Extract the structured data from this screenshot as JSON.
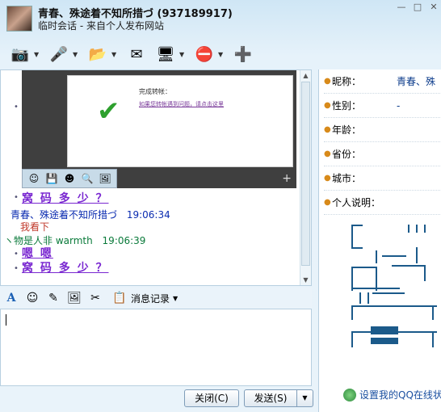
{
  "window": {
    "title": "青春、殊途着不知所措づ (937189917)",
    "subtitle": "临时会话 - 来自个人发布网站",
    "controls": [
      "—",
      "□",
      "✕"
    ]
  },
  "toolbar": {
    "items": [
      {
        "name": "video-icon",
        "glyph": "📷",
        "has_arrow": true
      },
      {
        "name": "voice-icon",
        "glyph": "🎤",
        "has_arrow": true
      },
      {
        "name": "file-transfer-icon",
        "glyph": "📂",
        "has_arrow": true
      },
      {
        "name": "mail-icon",
        "glyph": "✉",
        "has_arrow": false
      },
      {
        "name": "remote-assist-icon",
        "glyph": "🖥",
        "has_arrow": true
      },
      {
        "name": "block-icon",
        "glyph": "⛔",
        "has_arrow": true
      },
      {
        "name": "add-friend-icon",
        "glyph": "➕",
        "has_arrow": false
      }
    ]
  },
  "chat": {
    "screenshot": {
      "title": "完成转帐：",
      "link": "如果您转帐遇到问题，请点击这里",
      "zoom": "+"
    },
    "messages": [
      {
        "type": "big",
        "text": "窝 码 多 少 ？"
      },
      {
        "type": "header",
        "sender": "青春、殊途着不知所措づ",
        "time": "19:06:34"
      },
      {
        "type": "body",
        "text": "我看下"
      },
      {
        "type": "header2",
        "sender": "ヽ物是人非 warmth",
        "time": "19:06:39"
      },
      {
        "type": "big",
        "text": "嗯 嗯"
      },
      {
        "type": "big",
        "text": "窝 码 多 少 ？"
      }
    ]
  },
  "format_bar": {
    "history_label": "消息记录"
  },
  "buttons": {
    "close": "关闭(C)",
    "send": "发送(S)"
  },
  "profile": {
    "fields": [
      {
        "label": "昵称：",
        "value": "青春、殊"
      },
      {
        "label": "性别：",
        "value": "-"
      },
      {
        "label": "年龄：",
        "value": ""
      },
      {
        "label": "省份：",
        "value": ""
      },
      {
        "label": "城市：",
        "value": ""
      },
      {
        "label": "个人说明：",
        "value": ""
      }
    ],
    "status_link": "设置我的QQ在线状"
  }
}
